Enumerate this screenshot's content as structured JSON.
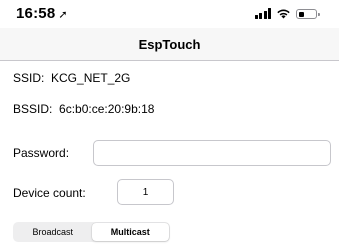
{
  "status_bar": {
    "time": "16:58",
    "location_arrow": "➚",
    "icons": [
      "signal-icon",
      "wifi-icon",
      "battery-icon"
    ],
    "battery_level": 0.35
  },
  "nav": {
    "title": "EspTouch"
  },
  "network": {
    "ssid_label": "SSID:",
    "ssid_value": "KCG_NET_2G",
    "bssid_label": "BSSID:",
    "bssid_value": "6c:b0:ce:20:9b:18"
  },
  "password": {
    "label": "Password:",
    "value": "",
    "placeholder": ""
  },
  "device_count": {
    "label": "Device count:",
    "value": "1"
  },
  "mode": {
    "options": [
      "Broadcast",
      "Multicast"
    ],
    "selected": "Multicast"
  }
}
